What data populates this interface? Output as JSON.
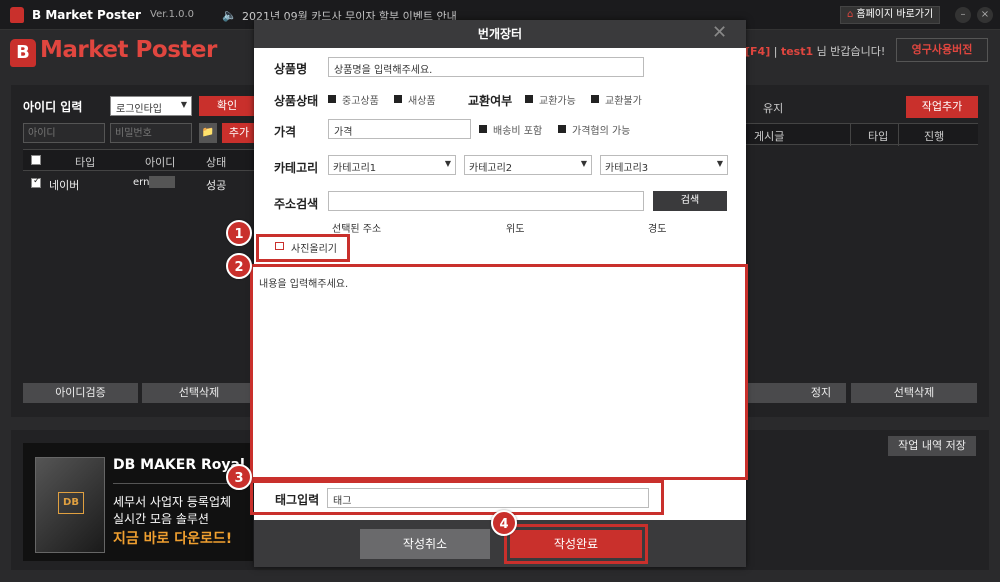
{
  "titlebar": {
    "app_name": "B Market Poster",
    "version": "Ver.1.0.0",
    "notice": "2021년 09월 카드사 무이자 할부 이벤트 안내",
    "home_button": "홈페이지 바로가기",
    "minimize": "–",
    "close": "×"
  },
  "header": {
    "logo_letter": "B",
    "brand": "Market Poster",
    "welcome_tag": "[F4]",
    "welcome_user": "test1",
    "welcome_sep": "|",
    "welcome_suffix": "님 반갑습니다!",
    "license_button": "영구사용버전"
  },
  "left_panel": {
    "title": "아이디 입력",
    "login_type": "로그인타입",
    "confirm_button": "확인",
    "id_placeholder": "아이디",
    "pw_placeholder": "비밀번호",
    "add_button": "추가",
    "columns": [
      "타입",
      "아이디",
      "상태"
    ],
    "rows": [
      {
        "type": "네이버",
        "id": "ern",
        "status": "성공"
      }
    ],
    "verify_button": "아이디검증",
    "delete_button": "선택삭제"
  },
  "right_panel": {
    "label": "유지",
    "add_work_button": "작업추가",
    "columns": [
      "게시글",
      "타입",
      "진행"
    ],
    "stop_button": "정지",
    "delete_button": "선택삭제",
    "save_log_button": "작업 내역 저장"
  },
  "ad": {
    "product": "DB MAKER Royal",
    "box_label": "DB",
    "line1": "세무서 사업자 등록업체",
    "line2": "실시간 모음 솔루션",
    "cta": "지금 바로 다운로드!"
  },
  "modal": {
    "title": "번개장터",
    "close": "✕",
    "product_name_label": "상품명",
    "product_name_value": "상품명을 입력해주세요.",
    "condition_label": "상품상태",
    "condition_options": [
      "중고상품",
      "새상품"
    ],
    "exchange_label": "교환여부",
    "exchange_options": [
      "교환가능",
      "교환불가"
    ],
    "price_label": "가격",
    "price_value": "가격",
    "price_options": [
      "배송비 포함",
      "가격협의 가능"
    ],
    "category_label": "카테고리",
    "categories": [
      "카테고리1",
      "카테고리2",
      "카테고리3"
    ],
    "address_label": "주소검색",
    "search_button": "검색",
    "addr_cols": [
      "선택된 주소",
      "위도",
      "경도"
    ],
    "photo_button": "사진올리기",
    "content_value": "내용을 입력해주세요.",
    "tag_label": "태그입력",
    "tag_value": "태그",
    "cancel_button": "작성취소",
    "submit_button": "작성완료"
  },
  "callouts": [
    "1",
    "2",
    "3",
    "4"
  ],
  "colors": {
    "accent": "#c9302c",
    "panel": "#222224",
    "bg": "#2a2a2c"
  }
}
